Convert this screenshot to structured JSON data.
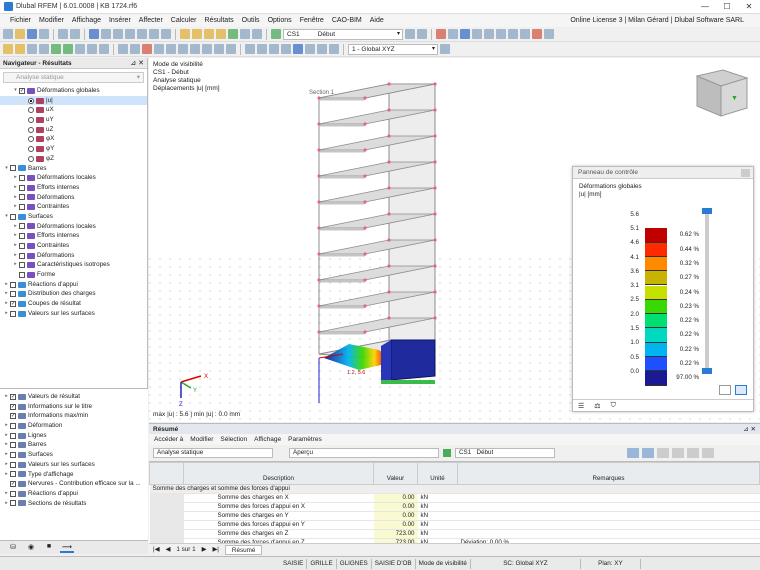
{
  "title": "Dlubal RFEM | 6.01.0008 | KB 1724.rf6",
  "menu": [
    "Fichier",
    "Modifier",
    "Affichage",
    "Insérer",
    "Affecter",
    "Calculer",
    "Résultats",
    "Outils",
    "Options",
    "Fenêtre",
    "CAO-BIM",
    "Aide"
  ],
  "license": "Online License 3 | Milan Gérard | Dlubal Software SARL",
  "toolbar": {
    "case_code": "CS1",
    "case_name": "Début",
    "view": "1 - Global XYZ"
  },
  "navigator": {
    "title": "Navigateur - Résultats",
    "select": "Analyse statique",
    "tree": [
      {
        "label": "Déformations globales",
        "level": 1,
        "check": true,
        "exp": "v"
      },
      {
        "label": "|u|",
        "level": 2,
        "radio": true,
        "sel": true
      },
      {
        "label": "uX",
        "level": 2,
        "radio": true
      },
      {
        "label": "uY",
        "level": 2,
        "radio": true
      },
      {
        "label": "uZ",
        "level": 2,
        "radio": true
      },
      {
        "label": "φX",
        "level": 2,
        "radio": true
      },
      {
        "label": "φY",
        "level": 2,
        "radio": true
      },
      {
        "label": "φZ",
        "level": 2,
        "radio": true
      },
      {
        "label": "Barres",
        "level": 0,
        "check": false,
        "exp": "v"
      },
      {
        "label": "Déformations locales",
        "level": 1,
        "check": false,
        "exp": ">"
      },
      {
        "label": "Efforts internes",
        "level": 1,
        "check": false,
        "exp": ">"
      },
      {
        "label": "Déformations",
        "level": 1,
        "check": false,
        "exp": ">"
      },
      {
        "label": "Contraintes",
        "level": 1,
        "check": false,
        "exp": ">"
      },
      {
        "label": "Surfaces",
        "level": 0,
        "check": false,
        "exp": "v"
      },
      {
        "label": "Déformations locales",
        "level": 1,
        "check": false,
        "exp": ">"
      },
      {
        "label": "Efforts internes",
        "level": 1,
        "check": false,
        "exp": ">"
      },
      {
        "label": "Contraintes",
        "level": 1,
        "check": false,
        "exp": ">"
      },
      {
        "label": "Déformations",
        "level": 1,
        "check": false,
        "exp": ">"
      },
      {
        "label": "Caractéristiques isotropes",
        "level": 1,
        "check": false,
        "exp": ">"
      },
      {
        "label": "Forme",
        "level": 1,
        "check": false,
        "exp": ""
      },
      {
        "label": "Réactions d'appui",
        "level": 0,
        "check": false,
        "exp": ">"
      },
      {
        "label": "Distribution des charges",
        "level": 0,
        "check": false,
        "exp": ">"
      },
      {
        "label": "Coupes de résultat",
        "level": 0,
        "check": true,
        "exp": ">"
      },
      {
        "label": "Valeurs sur les surfaces",
        "level": 0,
        "check": false,
        "exp": ">"
      }
    ],
    "tree2": [
      {
        "label": "Valeurs de résultat",
        "check": true,
        "exp": ">"
      },
      {
        "label": "Informations sur le titre",
        "check": true,
        "exp": ""
      },
      {
        "label": "Informations max/min",
        "check": true,
        "exp": ""
      },
      {
        "label": "Déformation",
        "check": false,
        "exp": ">"
      },
      {
        "label": "Lignes",
        "check": false,
        "exp": ">"
      },
      {
        "label": "Barres",
        "check": false,
        "exp": ">"
      },
      {
        "label": "Surfaces",
        "check": false,
        "exp": ">"
      },
      {
        "label": "Valeurs sur les surfaces",
        "check": false,
        "exp": ">"
      },
      {
        "label": "Type d'affichage",
        "check": false,
        "exp": ">"
      },
      {
        "label": "Nervures - Contribution efficace sur la ...",
        "check": true,
        "exp": ""
      },
      {
        "label": "Réactions d'appui",
        "check": false,
        "exp": ">"
      },
      {
        "label": "Sections de résultats",
        "check": false,
        "exp": ">"
      }
    ]
  },
  "viewport": {
    "info": [
      "Mode de visibilité",
      "CS1 - Début",
      "Analyse statique",
      "Déplacements |u| [mm]"
    ],
    "section_label": "Section 1",
    "value_label": "1.2, 5.6",
    "maxmin": "max |u| : 5.6 | min |u| : 0.0 mm",
    "axis_x": "X",
    "axis_y": "Y",
    "axis_z": "Z"
  },
  "control_panel": {
    "title": "Panneau de contrôle",
    "heading": "Déformations globales",
    "unit": "|u| [mm]",
    "legend": [
      {
        "value": "5.6",
        "color": "",
        "pct": ""
      },
      {
        "value": "5.1",
        "color": "#c00000",
        "pct": "0.62 %"
      },
      {
        "value": "4.6",
        "color": "#ff2a00",
        "pct": "0.44 %"
      },
      {
        "value": "4.1",
        "color": "#ff8a00",
        "pct": "0.32 %"
      },
      {
        "value": "3.6",
        "color": "#c8b400",
        "pct": "0.27 %"
      },
      {
        "value": "3.1",
        "color": "#c8e000",
        "pct": "0.24 %"
      },
      {
        "value": "2.5",
        "color": "#3ad800",
        "pct": "0.23 %"
      },
      {
        "value": "2.0",
        "color": "#00e070",
        "pct": "0.22 %"
      },
      {
        "value": "1.5",
        "color": "#00d8c0",
        "pct": "0.22 %"
      },
      {
        "value": "1.0",
        "color": "#00b4f0",
        "pct": "0.22 %"
      },
      {
        "value": "0.5",
        "color": "#1e50ff",
        "pct": "0.22 %"
      },
      {
        "value": "0.0",
        "color": "#1a1a96",
        "pct": "97.00 %"
      }
    ]
  },
  "summary": {
    "title": "Résumé",
    "menu": [
      "Accéder à",
      "Modifier",
      "Sélection",
      "Affichage",
      "Paramètres"
    ],
    "analysis": "Analyse statique",
    "view": "Aperçu",
    "case_code": "CS1",
    "case_name": "Début",
    "headers": [
      "Description",
      "Valeur",
      "Unité",
      "Remarques"
    ],
    "group": "Somme des charges et somme des forces d'appui",
    "rows": [
      {
        "d": "Somme des charges en X",
        "v": "0.00",
        "u": "kN",
        "r": ""
      },
      {
        "d": "Somme des forces d'appui en X",
        "v": "0.00",
        "u": "kN",
        "r": ""
      },
      {
        "d": "Somme des charges en Y",
        "v": "0.00",
        "u": "kN",
        "r": ""
      },
      {
        "d": "Somme des forces d'appui en Y",
        "v": "0.00",
        "u": "kN",
        "r": ""
      },
      {
        "d": "Somme des charges en Z",
        "v": "723.00",
        "u": "kN",
        "r": ""
      },
      {
        "d": "Somme des forces d'appui en Z",
        "v": "723.00",
        "u": "kN",
        "r": "Déviation: 0.00 %"
      }
    ],
    "pager": "1 sur 1",
    "tab": "Résumé"
  },
  "status": [
    "SAISIE",
    "GRILLE",
    "GLIGNES",
    "SAISIE D'OB",
    "Mode de visibilité",
    "SC: Global XYZ",
    "Plan: XY"
  ]
}
